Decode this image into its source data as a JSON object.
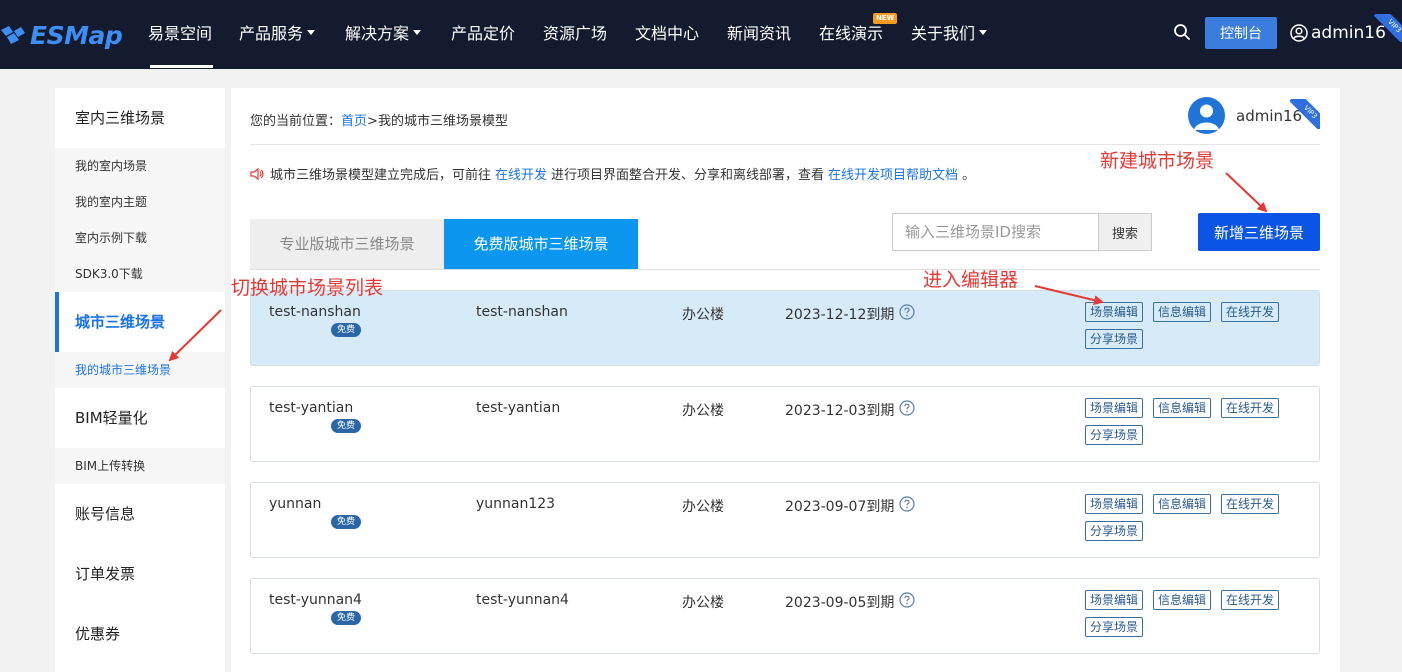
{
  "brand": {
    "name": "ESMap"
  },
  "nav": {
    "items": [
      {
        "label": "易景空间",
        "dropdown": false
      },
      {
        "label": "产品服务",
        "dropdown": true
      },
      {
        "label": "解决方案",
        "dropdown": true
      },
      {
        "label": "产品定价",
        "dropdown": false
      },
      {
        "label": "资源广场",
        "dropdown": false
      },
      {
        "label": "文档中心",
        "dropdown": false
      },
      {
        "label": "新闻资讯",
        "dropdown": false
      },
      {
        "label": "在线演示",
        "dropdown": false
      },
      {
        "label": "关于我们",
        "dropdown": true
      }
    ],
    "new_badge": "NEW",
    "console_label": "控制台",
    "username": "admin16",
    "vip_label": "VIP3"
  },
  "sidebar": {
    "items": [
      {
        "label": "室内三维场景",
        "type": "main",
        "active": false
      },
      {
        "label": "我的室内场景",
        "type": "sub",
        "active": false
      },
      {
        "label": "我的室内主题",
        "type": "sub",
        "active": false
      },
      {
        "label": "室内示例下载",
        "type": "sub",
        "active": false
      },
      {
        "label": "SDK3.0下载",
        "type": "sub",
        "active": false
      },
      {
        "label": "城市三维场景",
        "type": "main",
        "active": true
      },
      {
        "label": "我的城市三维场景",
        "type": "sub",
        "active": true
      },
      {
        "label": "BIM轻量化",
        "type": "main",
        "active": false
      },
      {
        "label": "BIM上传转换",
        "type": "sub",
        "active": false
      },
      {
        "label": "账号信息",
        "type": "main",
        "active": false
      },
      {
        "label": "订单发票",
        "type": "main",
        "active": false
      },
      {
        "label": "优惠券",
        "type": "main",
        "active": false
      }
    ]
  },
  "main": {
    "breadcrumb": {
      "prefix": "您的当前位置：",
      "home": "首页",
      "sep": ">",
      "current": "我的城市三维场景模型"
    },
    "user": {
      "name": "admin16",
      "vip": "VIP3"
    },
    "notice": {
      "part1": "城市三维场景模型建立完成后，可前往",
      "link1": "在线开发",
      "part2": "进行项目界面整合开发、分享和离线部署，查看",
      "link2": "在线开发项目帮助文档",
      "part3": "。"
    },
    "tabs": [
      {
        "label": "专业版城市三维场景",
        "active": false
      },
      {
        "label": "免费版城市三维场景",
        "active": true
      }
    ],
    "search": {
      "placeholder": "输入三维场景ID搜索",
      "button": "搜索"
    },
    "add_button": "新增三维场景",
    "free_badge": "免费",
    "ops": [
      "场景编辑",
      "信息编辑",
      "在线开发",
      "分享场景"
    ],
    "rows": [
      {
        "name": "test-nanshan",
        "id": "test-nanshan",
        "type": "办公楼",
        "expire": "2023-12-12到期",
        "highlight": true
      },
      {
        "name": "test-yantian",
        "id": "test-yantian",
        "type": "办公楼",
        "expire": "2023-12-03到期",
        "highlight": false
      },
      {
        "name": "yunnan",
        "id": "yunnan123",
        "type": "办公楼",
        "expire": "2023-09-07到期",
        "highlight": false
      },
      {
        "name": "test-yunnan4",
        "id": "test-yunnan4",
        "type": "办公楼",
        "expire": "2023-09-05到期",
        "highlight": false
      }
    ]
  },
  "annotations": {
    "new_scene": "新建城市场景",
    "switch_list": "切换城市场景列表",
    "enter_editor": "进入编辑器"
  },
  "colors": {
    "nav_bg": "#141b2f",
    "accent": "#1a73e8",
    "tab_active": "#0b96f0",
    "add_btn": "#0b55e6",
    "annotation": "#e53935"
  }
}
